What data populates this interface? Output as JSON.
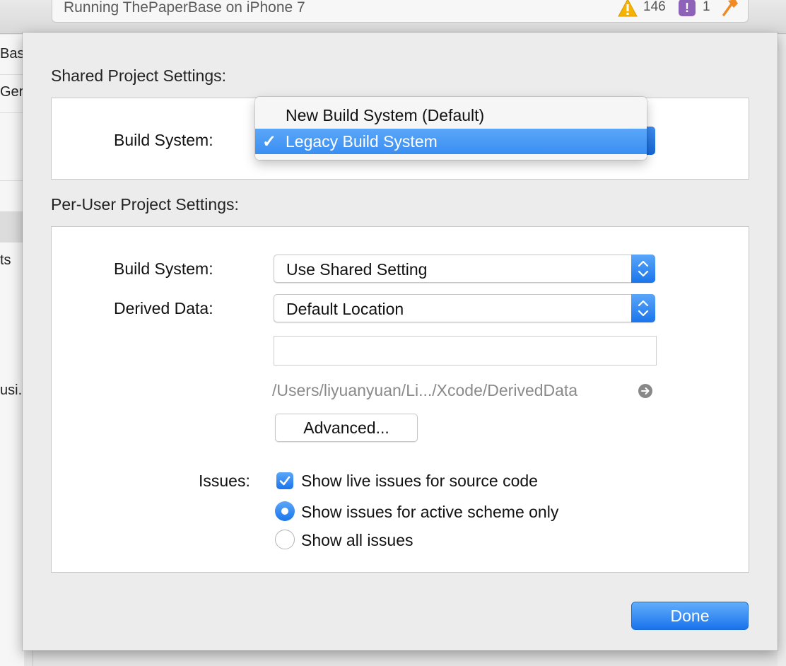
{
  "toolbar": {
    "activity_text": "Running ThePaperBase on iPhone 7",
    "warning_count": "146",
    "issue_badge": "!",
    "issue_count": "1"
  },
  "background_sidebar": {
    "items": [
      "Bas",
      "Ger",
      "ts",
      "usi.."
    ]
  },
  "shared": {
    "section_title": "Shared Project Settings:",
    "build_system_label": "Build System:",
    "menu": {
      "items": [
        {
          "label": "New Build System (Default)",
          "selected": false
        },
        {
          "label": "Legacy Build System",
          "selected": true
        }
      ],
      "check_glyph": "✓"
    }
  },
  "per_user": {
    "section_title": "Per-User Project Settings:",
    "build_system_label": "Build System:",
    "build_system_value": "Use Shared Setting",
    "derived_data_label": "Derived Data:",
    "derived_data_value": "Default Location",
    "custom_path_value": "",
    "derived_data_path": "/Users/liyuanyuan/Li.../Xcode/DerivedData",
    "advanced_button": "Advanced...",
    "issues_label": "Issues:",
    "show_live_issues": {
      "label": "Show live issues for source code",
      "checked": true
    },
    "issue_scope": {
      "options": [
        {
          "label": "Show issues for active scheme only",
          "selected": true
        },
        {
          "label": "Show all issues",
          "selected": false
        }
      ]
    }
  },
  "done_button": "Done",
  "colors": {
    "accent": "#1a75ec",
    "warning": "#f5b400",
    "issue_badge": "#8e62b9",
    "hammer": "#f08a24"
  }
}
